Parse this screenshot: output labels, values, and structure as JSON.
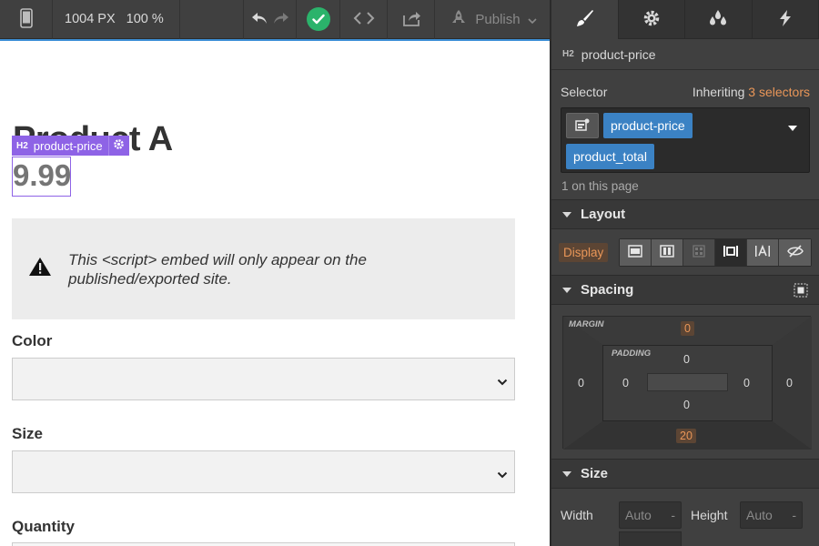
{
  "toolbar": {
    "width_value": "1004 PX",
    "zoom_value": "100 %",
    "publish_label": "Publish"
  },
  "canvas": {
    "product_title": "Product A",
    "price": "9.99",
    "selection_tag": {
      "tag_badge": "H2",
      "label": "product-price"
    },
    "embed_notice": "This <script> embed will only appear on the published/exported site.",
    "fields": [
      {
        "label": "Color"
      },
      {
        "label": "Size"
      },
      {
        "label": "Quantity"
      }
    ]
  },
  "panel": {
    "tabs": [
      "style-tab",
      "settings-tab",
      "style-manager-tab",
      "interactions-tab"
    ],
    "element": {
      "tag_badge": "H2",
      "name": "product-price"
    },
    "selector": {
      "label": "Selector",
      "inheriting_prefix": "Inheriting",
      "inheriting_count": "3 selectors",
      "chips": [
        "product-price",
        "product_total"
      ],
      "on_page": "1 on this page"
    },
    "layout": {
      "title": "Layout",
      "display_label": "Display"
    },
    "spacing": {
      "title": "Spacing",
      "margin_label": "MARGIN",
      "padding_label": "PADDING",
      "margin": {
        "top": "0",
        "right": "0",
        "bottom": "20",
        "left": "0"
      },
      "padding": {
        "top": "0",
        "right": "0",
        "bottom": "0",
        "left": "0"
      }
    },
    "size": {
      "title": "Size",
      "width_label": "Width",
      "width_value": "Auto",
      "height_label": "Height",
      "height_value": "Auto",
      "unit_dash": "-"
    }
  },
  "colors": {
    "selection": "#8e63e6",
    "chip": "#3b82c4",
    "accent_orange": "#e99658",
    "success": "#2bb36b",
    "panel_bg": "#404040"
  }
}
